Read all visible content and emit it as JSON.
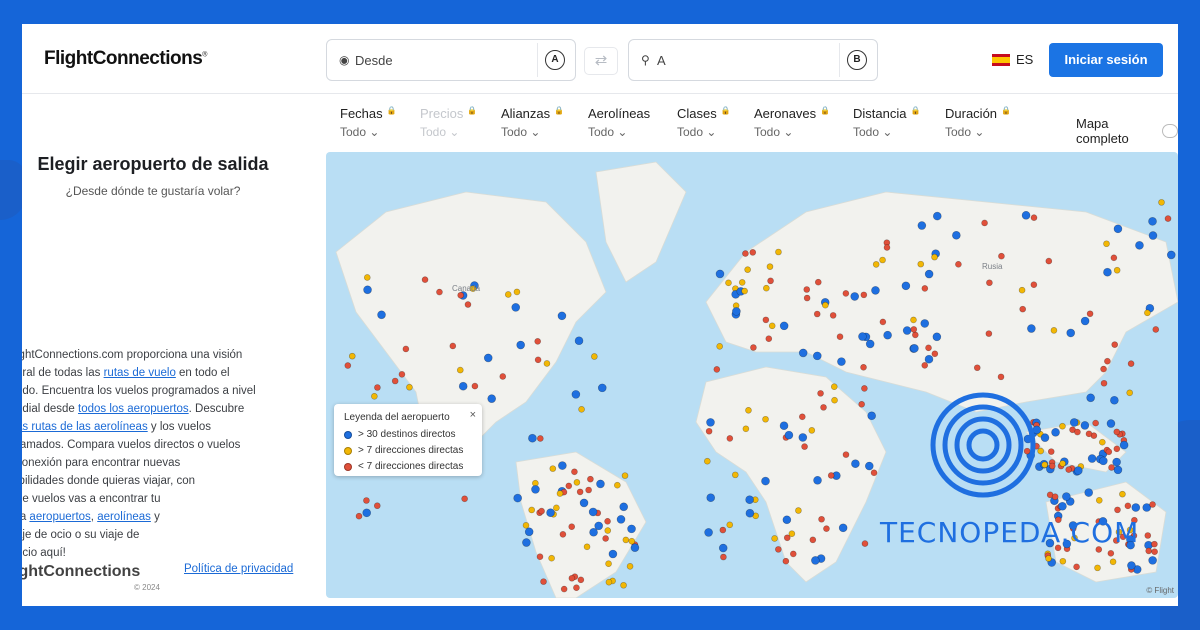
{
  "brand": "FlightConnections",
  "search": {
    "from_placeholder": "Desde",
    "from_badge": "A",
    "to_placeholder": "A",
    "to_badge": "B"
  },
  "header": {
    "language": "ES",
    "login_label": "Iniciar sesión"
  },
  "filters": [
    {
      "label": "Fechas",
      "value": "Todo",
      "locked": true
    },
    {
      "label": "Precios",
      "value": "Todo",
      "locked": true,
      "disabled": true
    },
    {
      "label": "Alianzas",
      "value": "Todo",
      "locked": true
    },
    {
      "label": "Aerolíneas",
      "value": "Todo",
      "locked": false
    },
    {
      "label": "Clases",
      "value": "Todo",
      "locked": true
    },
    {
      "label": "Aeronaves",
      "value": "Todo",
      "locked": true
    },
    {
      "label": "Distancia",
      "value": "Todo",
      "locked": true
    },
    {
      "label": "Duración",
      "value": "Todo",
      "locked": true
    }
  ],
  "full_map_label": "Mapa completo",
  "sidebar": {
    "title": "Elegir aeropuerto de salida",
    "subtitle": "¿Desde dónde te gustaría volar?",
    "desc_1": "ightConnections.com proporciona una visión",
    "desc_2a": "eral de todas las ",
    "desc_2_link": "rutas de vuelo",
    "desc_2b": " en todo el",
    "desc_3": "ndo. Encuentra los vuelos programados a nivel",
    "desc_4a": "ndial desde ",
    "desc_4_link": "todos los aeropuertos",
    "desc_4b": ". Descubre",
    "desc_5_link": "as rutas de las aerolíneas",
    "desc_5b": " y los vuelos",
    "desc_6": "ramados. Compara vuelos directos o vuelos",
    "desc_7": "conexión para encontrar nuevas",
    "desc_8": "ibilidades donde quieras viajar, con",
    "desc_9": "de vuelos vas a encontrar tu",
    "desc_10a": "ra ",
    "desc_10_link1": "aeropuertos",
    "desc_10_sep": ", ",
    "desc_10_link2": "aerolíneas",
    "desc_10b": " y",
    "desc_11": "aje de ocio o su viaje de",
    "desc_12": "ocio aquí!",
    "footer_brand": "ightConnections",
    "copyright": "© 2024",
    "privacy_label": "Política de privacidad"
  },
  "map": {
    "labels": {
      "canada": "Canadá",
      "russia": "Rusia"
    },
    "attribution": "© Flight",
    "legend": {
      "title": "Leyenda del aeropuerto",
      "close": "×",
      "items": [
        {
          "label": "> 30 destinos directos",
          "color": "#1e6fe0"
        },
        {
          "label": "> 7 direcciones directas",
          "color": "#f2b705"
        },
        {
          "label": "< 7 direcciones directas",
          "color": "#e0503a"
        }
      ]
    }
  },
  "watermark": {
    "text": "TECNOPEDA.COM"
  },
  "colors": {
    "accent": "#1b74e4",
    "frame": "#1565d8",
    "ocean": "#b9def4",
    "land": "#f2f2ee"
  }
}
